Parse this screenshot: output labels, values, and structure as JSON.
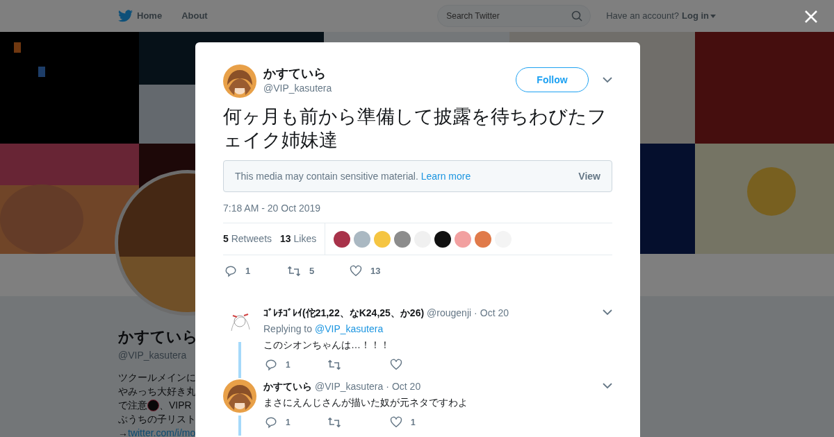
{
  "nav": {
    "items": [
      "Home",
      "About"
    ],
    "search": {
      "placeholder": "Search Twitter"
    },
    "account_prompt": "Have an account?",
    "login": "Log in"
  },
  "profile": {
    "name": "かすていら",
    "handle": "@VIP_kasutera",
    "bio": [
      {
        "kind": "text",
        "text": "ツクールメインに"
      },
      {
        "kind": "text",
        "text": "やみっち大好き丸"
      },
      {
        "kind": "badge",
        "before": "で注意",
        "after": "、VIPR"
      },
      {
        "kind": "text",
        "text": "ぶうちの子リスト"
      },
      {
        "kind": "link",
        "arrow": "→",
        "text": "twitter.com/i/mo"
      }
    ]
  },
  "tweet": {
    "name": "かすていら",
    "handle": "@VIP_kasutera",
    "follow": "Follow",
    "text": "何ヶ月も前から準備して披露を待ちわびたフェイク姉妹達",
    "sensitive": {
      "message": "This media may contain sensitive material.",
      "link": "Learn more",
      "button": "View"
    },
    "time": "7:18 AM - 20 Oct 2019",
    "stats": [
      {
        "count": "5",
        "label": "Retweets"
      },
      {
        "count": "13",
        "label": "Likes"
      }
    ],
    "likers": [
      {
        "color": "#a8324a"
      },
      {
        "color": "#aab8c2"
      },
      {
        "color": "#f5c542"
      },
      {
        "color": "#8c8c8c"
      },
      {
        "color": "#f0f0f0"
      },
      {
        "color": "#111111"
      },
      {
        "color": "#f2a0a0"
      },
      {
        "color": "#e07a4a"
      },
      {
        "color": "#f4f4f4"
      }
    ],
    "actions": {
      "replies": "1",
      "retweets": "5",
      "likes": "13"
    }
  },
  "replies": [
    {
      "name": "ｺﾞﾚﾁｺﾞﾚｲ(佗21,22、なK24,25、か26)",
      "handle": "@rougenji",
      "separator": "·",
      "date": "Oct 20",
      "replying_label": "Replying to",
      "replying_to": "@VIP_kasutera",
      "text": "このシオンちゃんは…！！！",
      "avatar": {
        "kind": "sketch"
      },
      "actions": {
        "replies": "1"
      }
    },
    {
      "name": "かすていら",
      "handle": "@VIP_kasutera",
      "separator": "·",
      "date": "Oct 20",
      "text": "まさにえんじさんが描いた奴が元ネタですわよ",
      "avatar": {
        "kind": "brown"
      },
      "actions": {
        "replies": "1",
        "likes": "1"
      }
    }
  ]
}
